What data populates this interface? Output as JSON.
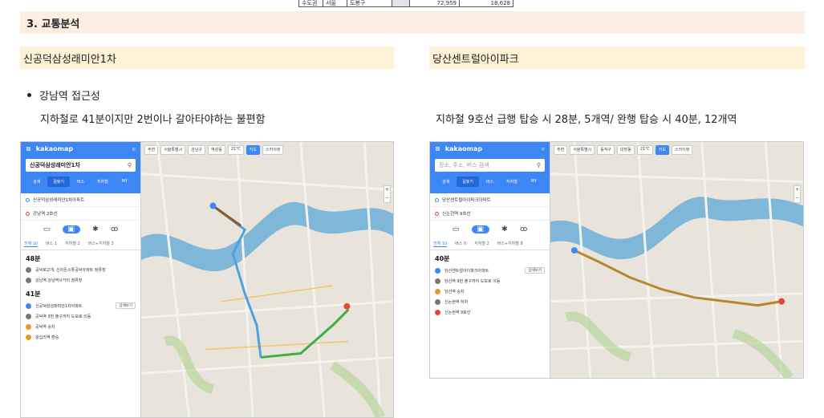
{
  "top_table": {
    "cells": [
      "수도권",
      "서울",
      "도봉구",
      "",
      "72,959",
      "18,628"
    ]
  },
  "section": {
    "title": "3.  교통분석"
  },
  "left": {
    "subtitle": "신공덕삼성래미안1차",
    "bullet": "강남역 접근성",
    "description": "지하철로 41분이지만 2번이나 갈아타야하는 불편함"
  },
  "right": {
    "subtitle": "당산센트럴아이파크",
    "description": "지하철 9호선 급행 탑승 시 28분, 5개역/ 완행 탑승 시 40분, 12개역"
  },
  "map_left": {
    "brand": "kakaomap",
    "search_value": "신공덕삼성래미안1차",
    "tabs": [
      "검색",
      "길찾기",
      "버스",
      "지하철",
      "MY"
    ],
    "origin": "신공덕삼성래미안1차아파트",
    "destination": "강남역 2호선",
    "subtabs": [
      "전체 10",
      "버스 1",
      "지하철 2",
      "버스+지하철 3"
    ],
    "route1_time": "48분",
    "route1_steps": [
      "공덕로고개, 신라돈스튜공덕아파트 정류장",
      "강남역.강남역사거리 정류장"
    ],
    "route2_time": "41분",
    "route2_steps": [
      "신공덕삼성래미안1차아파트",
      "공덕역 3번 출구까지 도보로 이동",
      "공덕역 승차",
      "왕십리역 환승"
    ],
    "toolbar": [
      "주변",
      "서울특별시",
      "강남구",
      "역삼동",
      "21℃",
      "지도",
      "스카이뷰"
    ],
    "btn_detail": "상세보기"
  },
  "map_right": {
    "brand": "kakaomap",
    "search_placeholder": "장소, 주소, 버스 검색",
    "tabs": [
      "검색",
      "길찾기",
      "버스",
      "지하철",
      "MY"
    ],
    "origin": "당산센트럴아이파크아파트",
    "destination": "신논현역 9호선",
    "subtabs": [
      "전체 10",
      "버스 0",
      "지하철 2",
      "버스+지하철 8"
    ],
    "route1_time": "40분",
    "route1_steps": [
      "당산센트럴아이파크아파트",
      "당산역 9번 출구까지 도보로 이동",
      "당산역 승차",
      "신논현역 하차",
      "신논현역 9호선"
    ],
    "toolbar": [
      "주변",
      "서울특별시",
      "동작구",
      "대방동",
      "21℃",
      "지도",
      "스카이뷰"
    ],
    "btn_detail": "상세보기"
  }
}
